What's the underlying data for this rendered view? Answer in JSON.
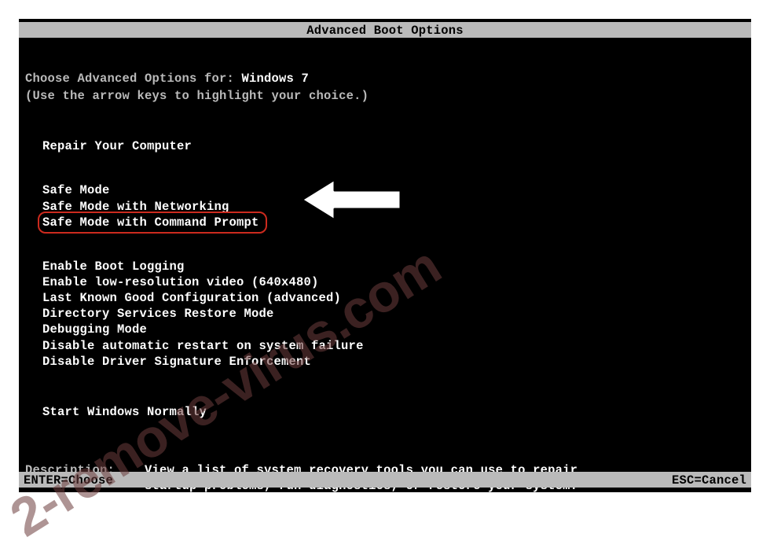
{
  "title": "Advanced Boot Options",
  "prompt": {
    "label": "Choose Advanced Options for: ",
    "os": "Windows 7"
  },
  "hint": "(Use the arrow keys to highlight your choice.)",
  "options": {
    "repair": "Repair Your Computer",
    "safe": "Safe Mode",
    "safe_net": "Safe Mode with Networking",
    "safe_cmd": "Safe Mode with Command Prompt",
    "boot_log": "Enable Boot Logging",
    "lowres": "Enable low-resolution video (640x480)",
    "lkgc": "Last Known Good Configuration (advanced)",
    "dsrm": "Directory Services Restore Mode",
    "debug": "Debugging Mode",
    "no_restart": "Disable automatic restart on system failure",
    "no_sig": "Disable Driver Signature Enforcement",
    "normal": "Start Windows Normally"
  },
  "description": {
    "label": "Description:    ",
    "text": "View a list of system recovery tools you can use to repair\nstartup problems, run diagnostics, or restore your system."
  },
  "footer": {
    "enter": "ENTER=Choose",
    "esc": "ESC=Cancel"
  },
  "watermark": "2-remove-virus.com"
}
